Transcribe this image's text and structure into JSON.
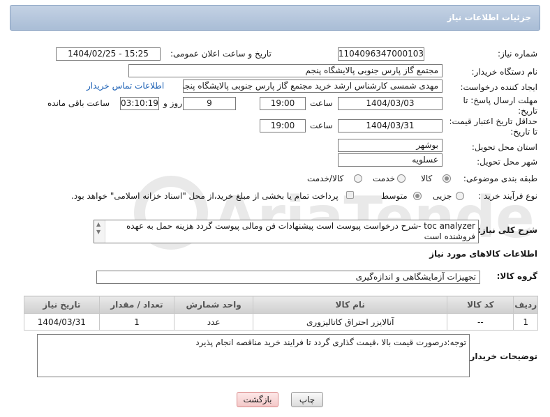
{
  "header": {
    "title": "جزئیات اطلاعات نیاز"
  },
  "form": {
    "need_number_label": "شماره نیاز:",
    "need_number": "1104096347000103",
    "announce_label": "تاریخ و ساعت اعلان عمومی:",
    "announce_value": "1404/02/25 - 15:25",
    "buyer_org_label": "نام دستگاه خریدار:",
    "buyer_org": "مجتمع گاز پارس جنوبی  پالایشگاه پنجم",
    "creator_label": "ایجاد کننده درخواست:",
    "creator": "مهدی شمسی کارشناس ارشد خرید مجتمع گاز پارس جنوبی  پالایشگاه پنجم",
    "contact_link": "اطلاعات تماس خریدار",
    "deadline_label_1": "مهلت ارسال پاسخ: تا",
    "deadline_label_2": "تاریخ:",
    "deadline_date": "1404/03/03",
    "time_label": "ساعت",
    "deadline_time": "19:00",
    "days_value": "9",
    "days_label": "روز و",
    "remaining_value": "03:10:19",
    "remaining_label": "ساعت باقی مانده",
    "validity_label_1": "حداقل تاریخ اعتبار قیمت:",
    "validity_label_2": "تا تاریخ:",
    "validity_date": "1404/03/31",
    "validity_time_label": "ساعت",
    "validity_time": "19:00",
    "province_label": "استان محل تحویل:",
    "province": "بوشهر",
    "city_label": "شهر محل تحویل:",
    "city": "عسلویه",
    "category_label": "طبقه بندی موضوعی:",
    "category_options": [
      "کالا",
      "خدمت",
      "کالا/خدمت"
    ],
    "category_selected": "کالا",
    "process_label": "نوع فرآیند خرید :",
    "process_options": [
      "جزیی",
      "متوسط"
    ],
    "process_selected": "متوسط",
    "payment_note": "پرداخت تمام یا بخشی از مبلغ خرید،از محل \"اسناد خزانه اسلامی\" خواهد بود.",
    "description_label": "شرح کلی نیاز:",
    "description": "toc analyzer -شرح درخواست پیوست است پیشنهادات فن ومالی پیوست گردد هزینه حمل به عهده فروشنده است"
  },
  "goods": {
    "section_title": "اطلاعات کالاهای مورد نیاز",
    "group_label": "گروه کالا:",
    "group_value": "تجهیزات آزمایشگاهی و اندازه‌گیری",
    "columns": [
      "ردیف",
      "کد کالا",
      "نام کالا",
      "واحد شمارش",
      "تعداد / مقدار",
      "تاریخ نیاز"
    ],
    "rows": [
      {
        "row": "1",
        "code": "--",
        "name": "آنالایزر احتراق کاتالیزوری",
        "unit": "عدد",
        "qty": "1",
        "date": "1404/03/31"
      }
    ]
  },
  "notes": {
    "label": "توضیحات خریدار:",
    "text": "توجه:درصورت قیمت بالا ،قیمت گذاری گردد تا فرایند خرید مناقصه انجام پذیرد"
  },
  "buttons": {
    "print": "چاپ",
    "back": "بازگشت"
  },
  "watermark": {
    "brand": "AriaTender.net"
  }
}
